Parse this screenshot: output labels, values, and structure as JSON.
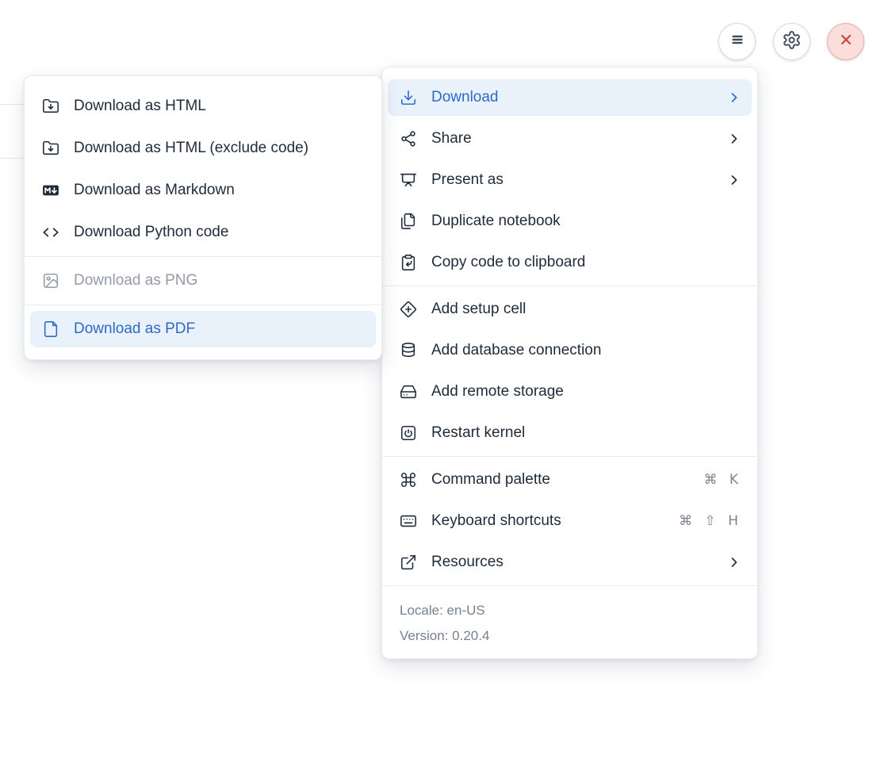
{
  "palette": {
    "accent_blue": "#2f6ac4",
    "accent_blue_bg": "#e9f1fb",
    "text_primary": "#1f2b3a",
    "text_disabled": "#949ca8",
    "text_muted": "#76818f",
    "danger_red": "#cf3f3b",
    "danger_bg": "#f9dedb",
    "separator": "#e8eaee"
  },
  "header": {
    "buttons": [
      {
        "name": "notebook-menu-button",
        "icon": "hamburger-icon"
      },
      {
        "name": "settings-button",
        "icon": "gear-icon"
      },
      {
        "name": "shutdown-button",
        "icon": "close-icon"
      }
    ]
  },
  "submenu": {
    "items": [
      {
        "label": "Download as HTML",
        "icon": "folder-down-icon",
        "state": "normal"
      },
      {
        "label": "Download as HTML (exclude code)",
        "icon": "folder-down-icon",
        "state": "normal"
      },
      {
        "label": "Download as Markdown",
        "icon": "markdown-icon",
        "state": "normal"
      },
      {
        "label": "Download Python code",
        "icon": "code-icon",
        "state": "normal"
      },
      {
        "label": "Download as PNG",
        "icon": "image-icon",
        "state": "disabled"
      },
      {
        "label": "Download as PDF",
        "icon": "file-icon",
        "state": "active"
      }
    ]
  },
  "menu": {
    "items": [
      {
        "label": "Download",
        "icon": "download-icon",
        "trailing": "chevron",
        "state": "active"
      },
      {
        "label": "Share",
        "icon": "share-icon",
        "trailing": "chevron"
      },
      {
        "label": "Present as",
        "icon": "presentation-icon",
        "trailing": "chevron"
      },
      {
        "label": "Duplicate notebook",
        "icon": "duplicate-icon"
      },
      {
        "label": "Copy code to clipboard",
        "icon": "clipboard-copy-icon"
      },
      {
        "label": "Add setup cell",
        "icon": "diamond-plus-icon"
      },
      {
        "label": "Add database connection",
        "icon": "database-icon"
      },
      {
        "label": "Add remote storage",
        "icon": "hard-drive-icon"
      },
      {
        "label": "Restart kernel",
        "icon": "power-icon"
      },
      {
        "label": "Command palette",
        "icon": "command-icon",
        "shortcut": "⌘ K"
      },
      {
        "label": "Keyboard shortcuts",
        "icon": "keyboard-icon",
        "shortcut": "⌘ ⇧ H"
      },
      {
        "label": "Resources",
        "icon": "external-link-icon",
        "trailing": "chevron"
      }
    ],
    "footer": {
      "locale": "Locale: en-US",
      "version": "Version: 0.20.4"
    }
  }
}
